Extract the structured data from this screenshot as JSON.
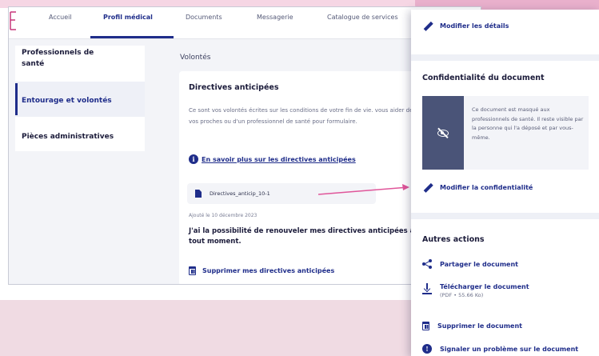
{
  "nav": {
    "tabs": [
      {
        "label": "Accueil"
      },
      {
        "label": "Profil médical"
      },
      {
        "label": "Documents"
      },
      {
        "label": "Messagerie"
      },
      {
        "label": "Catalogue de services"
      }
    ],
    "active_tab": "Profil médical"
  },
  "sidebar": {
    "items": [
      {
        "label": "Professionnels de santé"
      },
      {
        "label": "Entourage et volontés"
      },
      {
        "label": "Pièces administratives"
      }
    ],
    "active_item": "Entourage et volontés"
  },
  "main": {
    "section_label": "Volontés",
    "card": {
      "title": "Directives anticipées",
      "description": "Ce sont vos volontés écrites sur les conditions de votre fin de vie. vous aider de vos proches ou d'un professionnel de santé pour formulaire.",
      "info_link": "En savoir plus sur les directives anticipées",
      "file_name": "Directives_anticip_10-1",
      "added_date": "Ajouté le 10 décembre 2023",
      "renew_text": "J'ai la possibilité de renouveler mes directives anticipées à tout moment.",
      "delete_label": "Supprimer mes directives anticipées"
    }
  },
  "panel": {
    "modify_details": "Modifier les détails",
    "confidentiality_heading": "Confidentialité du document",
    "confidentiality_text": "Ce document est masqué aux professionnels de santé. Il reste visible par la personne qui l'a déposé et par vous-même.",
    "modify_confidentiality": "Modifier la confidentialité",
    "other_actions_heading": "Autres actions",
    "share": "Partager le document",
    "download": "Télécharger le document",
    "download_meta": "(PDF • 55.66 Ko)",
    "delete": "Supprimer le document",
    "report": "Signaler un problème sur le document"
  },
  "colors": {
    "primary": "#1f2d8a",
    "accent_pink": "#e0569a",
    "background_pink": "#f0dbe3"
  }
}
